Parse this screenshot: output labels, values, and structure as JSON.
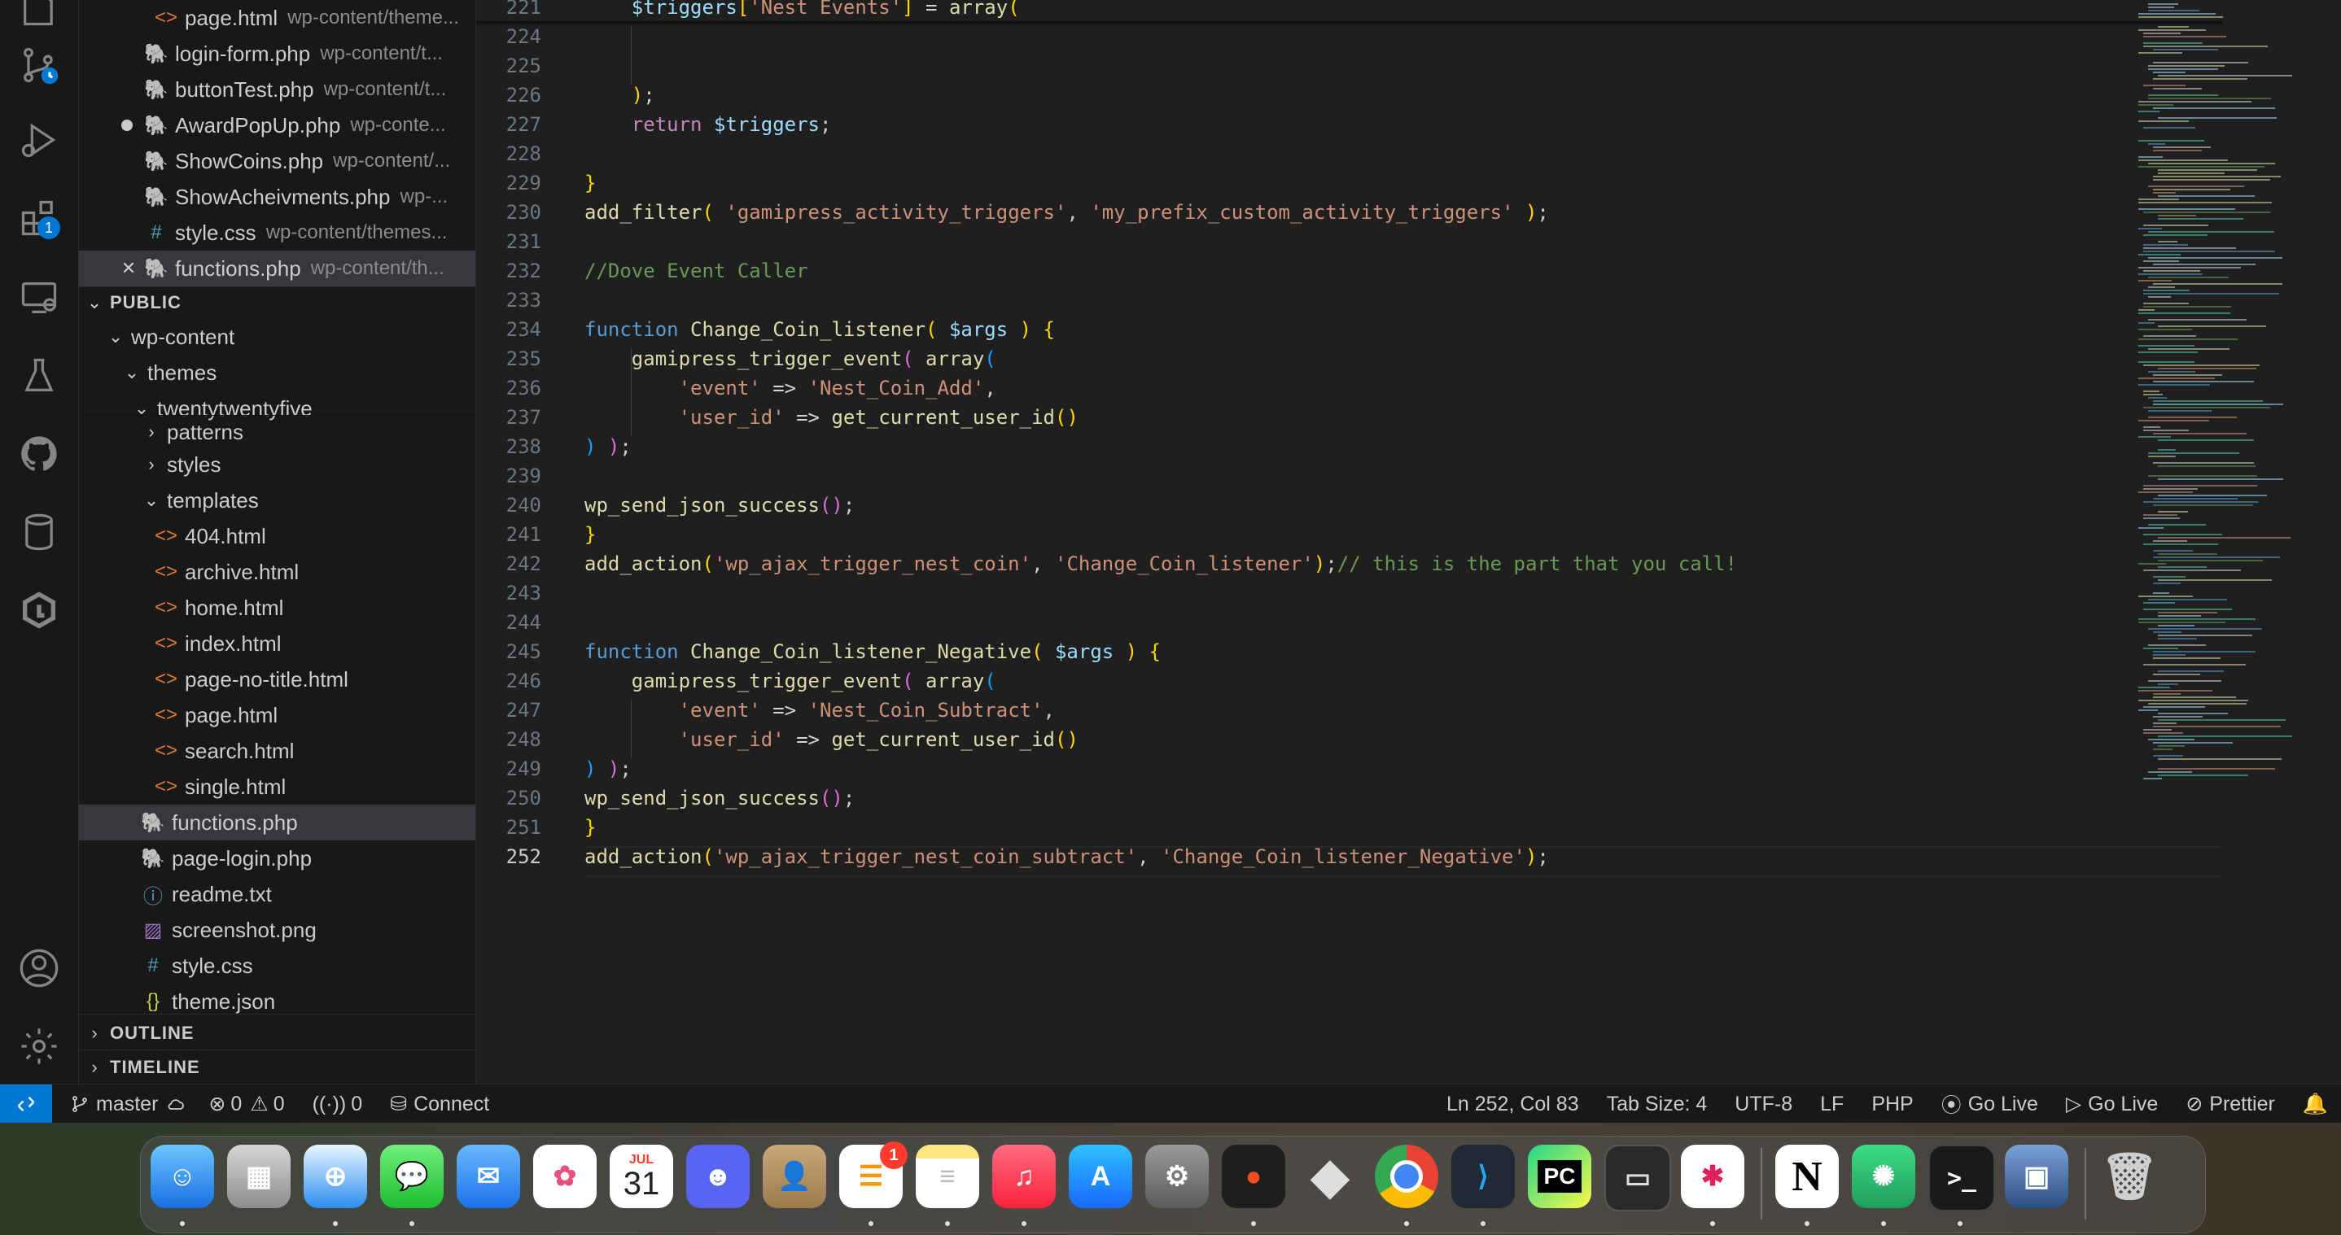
{
  "sidebar": {
    "open_editors": [
      {
        "name": "page.html",
        "desc": "wp-content/theme...",
        "icon": "html"
      },
      {
        "name": "login-form.php",
        "desc": "wp-content/t...",
        "icon": "php"
      },
      {
        "name": "buttonTest.php",
        "desc": "wp-content/t...",
        "icon": "php"
      },
      {
        "name": "AwardPopUp.php",
        "desc": "wp-conte...",
        "icon": "php",
        "modified": true
      },
      {
        "name": "ShowCoins.php",
        "desc": "wp-content/...",
        "icon": "php"
      },
      {
        "name": "ShowAcheivments.php",
        "desc": "wp-...",
        "icon": "php"
      },
      {
        "name": "style.css",
        "desc": "wp-content/themes...",
        "icon": "css"
      },
      {
        "name": "functions.php",
        "desc": "wp-content/th...",
        "icon": "php",
        "active": true
      }
    ],
    "public_header": "PUBLIC",
    "tree": {
      "wp_content": "wp-content",
      "themes": "themes",
      "theme": "twentytwentyfive",
      "patterns": "patterns",
      "styles": "styles",
      "templates": "templates",
      "template_files": [
        "404.html",
        "archive.html",
        "home.html",
        "index.html",
        "page-no-title.html",
        "page.html",
        "search.html",
        "single.html"
      ],
      "root_files": [
        {
          "name": "functions.php",
          "icon": "php",
          "selected": true
        },
        {
          "name": "page-login.php",
          "icon": "php"
        },
        {
          "name": "readme.txt",
          "icon": "txt"
        },
        {
          "name": "screenshot.png",
          "icon": "png"
        },
        {
          "name": "style.css",
          "icon": "css"
        },
        {
          "name": "theme.json",
          "icon": "json"
        }
      ]
    },
    "outline": "OUTLINE",
    "timeline": "TIMELINE"
  },
  "activity_badge": "1",
  "editor": {
    "active_line": "252",
    "lines": [
      {
        "n": "221",
        "html": "    <span class='vr'>$triggers</span><span class='br1'>[</span><span class='st'>'Nest Events'</span><span class='br1'>]</span> <span class='pn'>=</span> <span class='fn'>array</span><span class='br1'>(</span>"
      },
      {
        "n": "224",
        "html": ""
      },
      {
        "n": "225",
        "html": ""
      },
      {
        "n": "226",
        "html": "    <span class='br1'>)</span>;"
      },
      {
        "n": "227",
        "html": "    <span class='kw' style='color:#c586c0'>return</span> <span class='vr'>$triggers</span>;"
      },
      {
        "n": "228",
        "html": ""
      },
      {
        "n": "229",
        "html": "<span class='br1'>}</span>"
      },
      {
        "n": "230",
        "html": "<span class='fn'>add_filter</span><span class='br1'>(</span> <span class='st'>'gamipress_activity_triggers'</span>, <span class='st'>'my_prefix_custom_activity_triggers'</span> <span class='br1'>)</span>;"
      },
      {
        "n": "231",
        "html": ""
      },
      {
        "n": "232",
        "html": "<span class='cm'>//Dove Event Caller</span>"
      },
      {
        "n": "233",
        "html": ""
      },
      {
        "n": "234",
        "html": "<span class='kw'>function</span> <span class='fn'>Change_Coin_listener</span><span class='br1'>(</span> <span class='vr'>$args</span> <span class='br1'>)</span> <span class='br1'>{</span>"
      },
      {
        "n": "235",
        "html": "    <span class='fn'>gamipress_trigger_event</span><span class='br2'>(</span> <span class='fn'>array</span><span class='br3'>(</span>"
      },
      {
        "n": "236",
        "html": "        <span class='st'>'event'</span> <span class='pn'>=&gt;</span> <span class='st'>'Nest_Coin_Add'</span>,"
      },
      {
        "n": "237",
        "html": "        <span class='st'>'user_id'</span> <span class='pn'>=&gt;</span> <span class='fn'>get_current_user_id</span><span class='br1'>()</span>"
      },
      {
        "n": "238",
        "html": "<span class='br3'>)</span> <span class='br2'>)</span>;"
      },
      {
        "n": "239",
        "html": ""
      },
      {
        "n": "240",
        "html": "<span class='fn'>wp_send_json_success</span><span class='br2'>()</span>;"
      },
      {
        "n": "241",
        "html": "<span class='br1'>}</span>"
      },
      {
        "n": "242",
        "html": "<span class='fn'>add_action</span><span class='br1'>(</span><span class='st'>'wp_ajax_trigger_nest_coin'</span>, <span class='st'>'Change_Coin_listener'</span><span class='br1'>)</span>;<span class='cm'>// this is the part that you call!</span>"
      },
      {
        "n": "243",
        "html": ""
      },
      {
        "n": "244",
        "html": ""
      },
      {
        "n": "245",
        "html": "<span class='kw'>function</span> <span class='fn'>Change_Coin_listener_Negative</span><span class='br1'>(</span> <span class='vr'>$args</span> <span class='br1'>)</span> <span class='br1'>{</span>"
      },
      {
        "n": "246",
        "html": "    <span class='fn'>gamipress_trigger_event</span><span class='br2'>(</span> <span class='fn'>array</span><span class='br3'>(</span>"
      },
      {
        "n": "247",
        "html": "        <span class='st'>'event'</span> <span class='pn'>=&gt;</span> <span class='st'>'Nest_Coin_Subtract'</span>,"
      },
      {
        "n": "248",
        "html": "        <span class='st'>'user_id'</span> <span class='pn'>=&gt;</span> <span class='fn'>get_current_user_id</span><span class='br1'>()</span>"
      },
      {
        "n": "249",
        "html": "<span class='br3'>)</span> <span class='br2'>)</span>;"
      },
      {
        "n": "250",
        "html": "<span class='fn'>wp_send_json_success</span><span class='br2'>()</span>;"
      },
      {
        "n": "251",
        "html": "<span class='br1'>}</span>"
      },
      {
        "n": "252",
        "html": "<span class='fn'>add_action</span><span class='br1'>(</span><span class='st'>'wp_ajax_trigger_nest_coin_subtract'</span>, <span class='st'>'Change_Coin_listener_Negative'</span><span class='br1'>)</span>;"
      }
    ]
  },
  "statusbar": {
    "branch": "master",
    "errors": "0",
    "warnings": "0",
    "ports": "0",
    "connect": "Connect",
    "position": "Ln 252, Col 83",
    "tab_size": "Tab Size: 4",
    "encoding": "UTF-8",
    "eol": "LF",
    "language": "PHP",
    "go_live_1": "Go Live",
    "go_live_2": "Go Live",
    "prettier": "Prettier"
  },
  "dock": {
    "calendar_month": "JUL",
    "calendar_day": "31",
    "reminders_badge": "1",
    "pycharm_label": "PC",
    "notion_label": "N",
    "terminal_prompt": ">_"
  }
}
